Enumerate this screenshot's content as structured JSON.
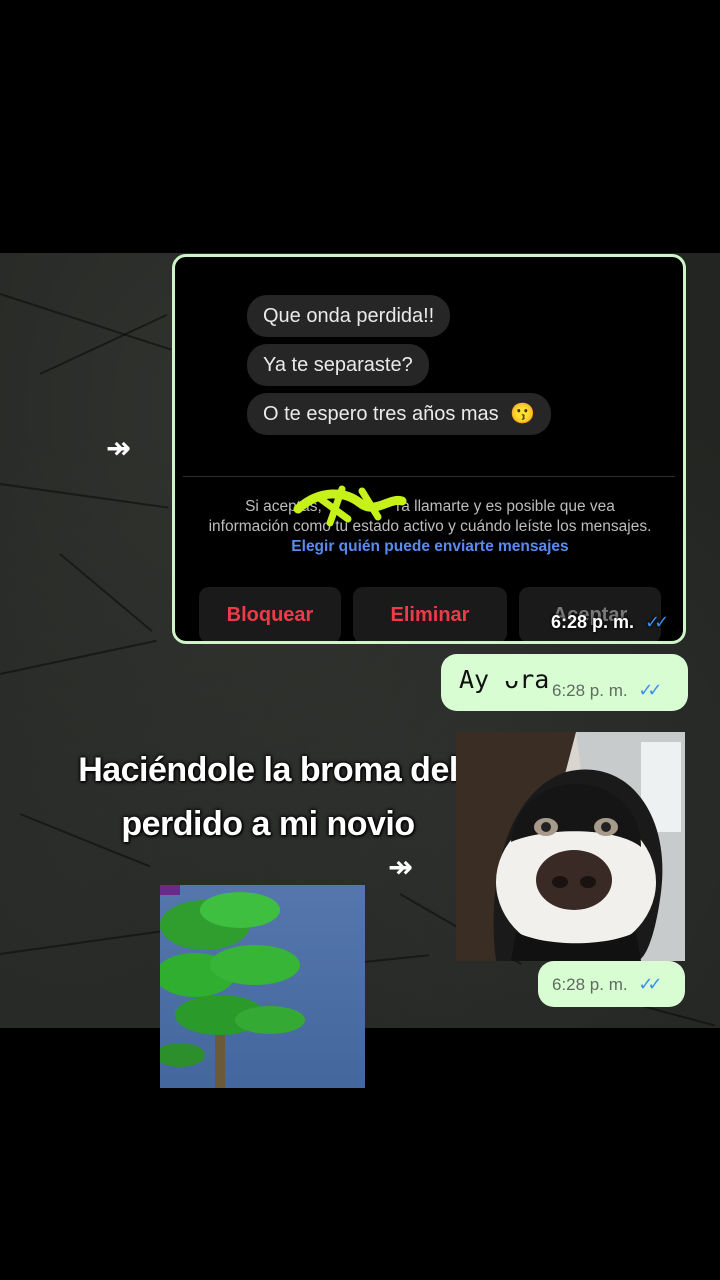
{
  "screenshot": {
    "messages": [
      "Que onda perdida!!",
      "Ya te separaste?",
      "O te espero tres años mas"
    ],
    "emoji": "😗",
    "notice_part1": "Si aceptas,",
    "notice_part2": "ra llamarte y es posible que vea",
    "notice_part3": "información como tu estado activo y cuándo leíste los mensajes.",
    "notice_link": "Elegir quién puede enviarte mensajes",
    "buttons": {
      "block": "Bloquear",
      "delete": "Eliminar",
      "accept": "Aceptar"
    },
    "time": "6:28 p. m."
  },
  "reply": {
    "text": "Ay ᴗra",
    "time": "6:28 p. m."
  },
  "image_message": {
    "time": "6:28 p. m."
  },
  "caption": {
    "line1": "Haciéndole la broma del",
    "line2": "perdido a mi novio"
  },
  "icons": {
    "forward": "↠",
    "read_ticks": "✓✓"
  },
  "colors": {
    "outgoing_bubble": "#d9fdd3",
    "read_ticks": "#3a8ff0",
    "danger": "#ef3b49",
    "link": "#5a8cf0",
    "frame": "#cdf5c8"
  }
}
